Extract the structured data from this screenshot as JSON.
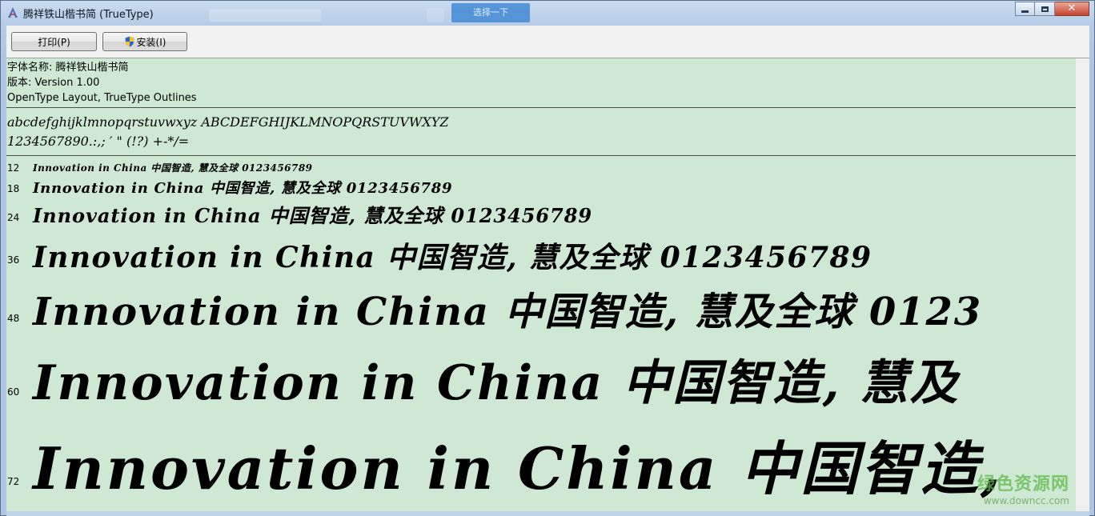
{
  "window": {
    "title": "腾祥铁山楷书简 (TrueType)",
    "ghost_button": "选择一下"
  },
  "toolbar": {
    "print_label": "打印(P)",
    "install_label": "安装(I)"
  },
  "font_info": {
    "name_line": "字体名称: 腾祥铁山楷书简",
    "version_line": "版本: Version  1.00",
    "type_line": "OpenType Layout, TrueType Outlines"
  },
  "charset": {
    "letters": "abcdefghijklmnopqrstuvwxyz  ABCDEFGHIJKLMNOPQRSTUVWXYZ",
    "digits": "1234567890.:,; ′ \" (!?) +-*/="
  },
  "samples": [
    {
      "size": "12",
      "text": "Innovation in China 中国智造, 慧及全球 0123456789"
    },
    {
      "size": "18",
      "text": "Innovation in China 中国智造, 慧及全球 0123456789"
    },
    {
      "size": "24",
      "text": "Innovation in China 中国智造, 慧及全球 0123456789"
    },
    {
      "size": "36",
      "text": "Innovation in China 中国智造, 慧及全球 0123456789"
    },
    {
      "size": "48",
      "text": "Innovation in China 中国智造, 慧及全球 0123"
    },
    {
      "size": "60",
      "text": "Innovation in China 中国智造, 慧及"
    },
    {
      "size": "72",
      "text": "Innovation in China 中国智造,"
    }
  ],
  "watermark": {
    "title": "绿色资源网",
    "url": "www.downcc.com"
  },
  "colors": {
    "pane_background": "#cee8d4",
    "close_button": "#c7452e"
  }
}
